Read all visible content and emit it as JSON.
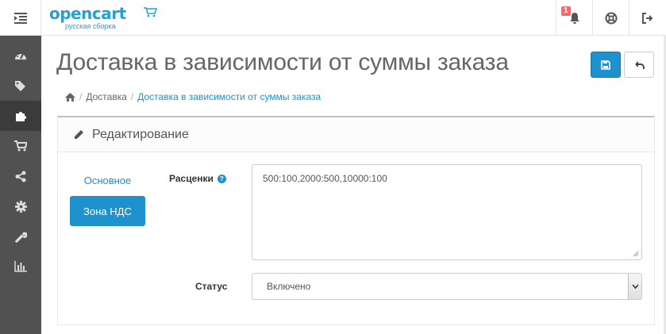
{
  "header": {
    "logo_text": "opencart",
    "logo_subtext": "русская сборка",
    "notification_count": "1"
  },
  "sidebar": {
    "items": [
      {
        "icon": "dashboard-icon",
        "active": false
      },
      {
        "icon": "tags-icon",
        "active": false
      },
      {
        "icon": "puzzle-icon",
        "active": true
      },
      {
        "icon": "cart-icon",
        "active": false
      },
      {
        "icon": "share-icon",
        "active": false
      },
      {
        "icon": "gear-icon",
        "active": false
      },
      {
        "icon": "wrench-icon",
        "active": false
      },
      {
        "icon": "bar-chart-icon",
        "active": false
      }
    ]
  },
  "page": {
    "title": "Доставка в зависимости от суммы заказа"
  },
  "breadcrumb": {
    "items": [
      {
        "label": "Доставка"
      },
      {
        "label": "Доставка в зависимости от суммы заказа"
      }
    ]
  },
  "panel": {
    "title": "Редактирование"
  },
  "tabs": {
    "general": "Основное",
    "tax_zone": "Зона НДС"
  },
  "form": {
    "rates_label": "Расценки",
    "rates_value": "500:100,2000:500,10000:100",
    "status_label": "Статус",
    "status_value": "Включено"
  },
  "colors": {
    "accent": "#1e91cf",
    "sidebar_bg": "#515151",
    "badge": "#f56b6b"
  }
}
